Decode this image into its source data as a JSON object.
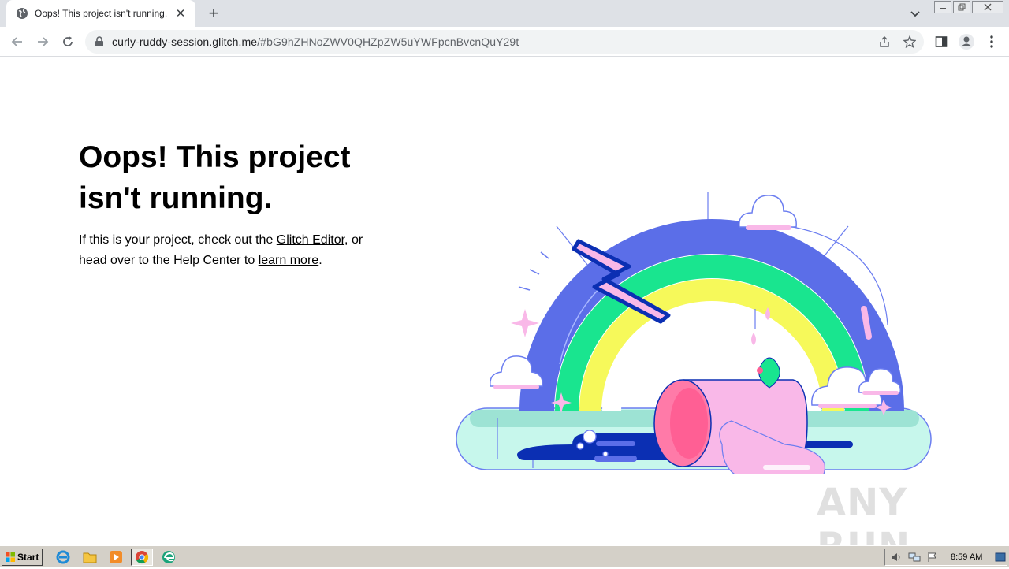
{
  "browser": {
    "tab_title": "Oops! This project isn't running.",
    "new_tab_glyph": "+",
    "close_glyph": "✕",
    "url_host": "curly-ruddy-session.glitch.me",
    "url_path": "/#bG9hZHNoZWV0QHZpZW5uYWFpcnBvcnQuY29t",
    "icons": [
      "back-icon",
      "forward-icon",
      "reload-icon",
      "lock-icon",
      "share-icon",
      "star-icon",
      "side-panel-icon",
      "profile-icon",
      "menu-icon"
    ]
  },
  "page": {
    "heading": "Oops! This project isn't running.",
    "para_prefix": "If this is your project, check out the ",
    "link_editor": "Glitch Editor",
    "para_middle": ", or head over to the Help Center to ",
    "link_learn": "learn more",
    "para_suffix": ".",
    "watermark": "ANY RUN"
  },
  "taskbar": {
    "start_label": "Start",
    "clock": "8:59 AM",
    "apps": [
      "ie-icon",
      "explorer-icon",
      "media-player-icon",
      "chrome-icon",
      "edge-icon"
    ]
  },
  "colors": {
    "rainbow_blue": "#5b6ee8",
    "rainbow_green": "#19e58f",
    "rainbow_yellow": "#f6f95a",
    "pink": "#f9b8e8",
    "navy": "#0b2fb3",
    "water": "#b8f0e4"
  }
}
